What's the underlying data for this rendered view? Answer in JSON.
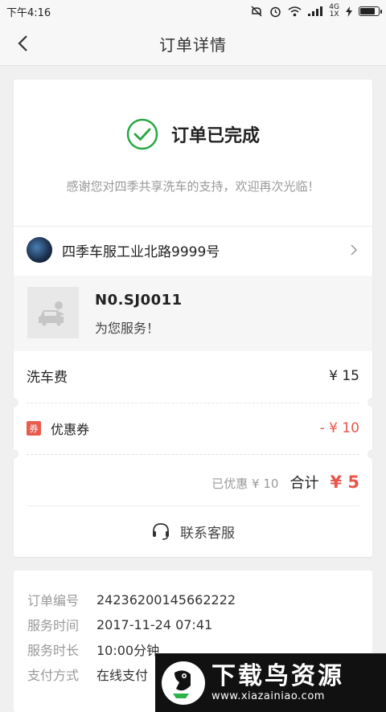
{
  "status_bar": {
    "time": "下午4:16",
    "network": "4G",
    "network_sub": "1X"
  },
  "header": {
    "title": "订单详情"
  },
  "order_status": {
    "title": "订单已完成",
    "message": "感谢您对四季共享洗车的支持，欢迎再次光临！",
    "accent_color": "#27a844"
  },
  "store": {
    "name": "四季车服工业北路9999号"
  },
  "service": {
    "number": "N0.SJ0011",
    "message": "为您服务！"
  },
  "fees": {
    "wash_label": "洗车费",
    "wash_value": "¥ 15",
    "coupon_badge": "券",
    "coupon_label": "优惠券",
    "coupon_value": "- ¥ 10",
    "saved": "已优惠 ¥ 10",
    "total_label": "合计",
    "total_value": "¥ 5",
    "accent_color": "#e8564a"
  },
  "customer_service": {
    "label": "联系客服"
  },
  "order_info": [
    {
      "label": "订单编号",
      "value": "24236200145662222"
    },
    {
      "label": "服务时间",
      "value": "2017-11-24 07:41"
    },
    {
      "label": "服务时长",
      "value": "10:00分钟"
    },
    {
      "label": "支付方式",
      "value": "在线支付"
    }
  ],
  "watermark": {
    "title": "下载鸟资源",
    "url": "www.xiazainiao.com"
  }
}
